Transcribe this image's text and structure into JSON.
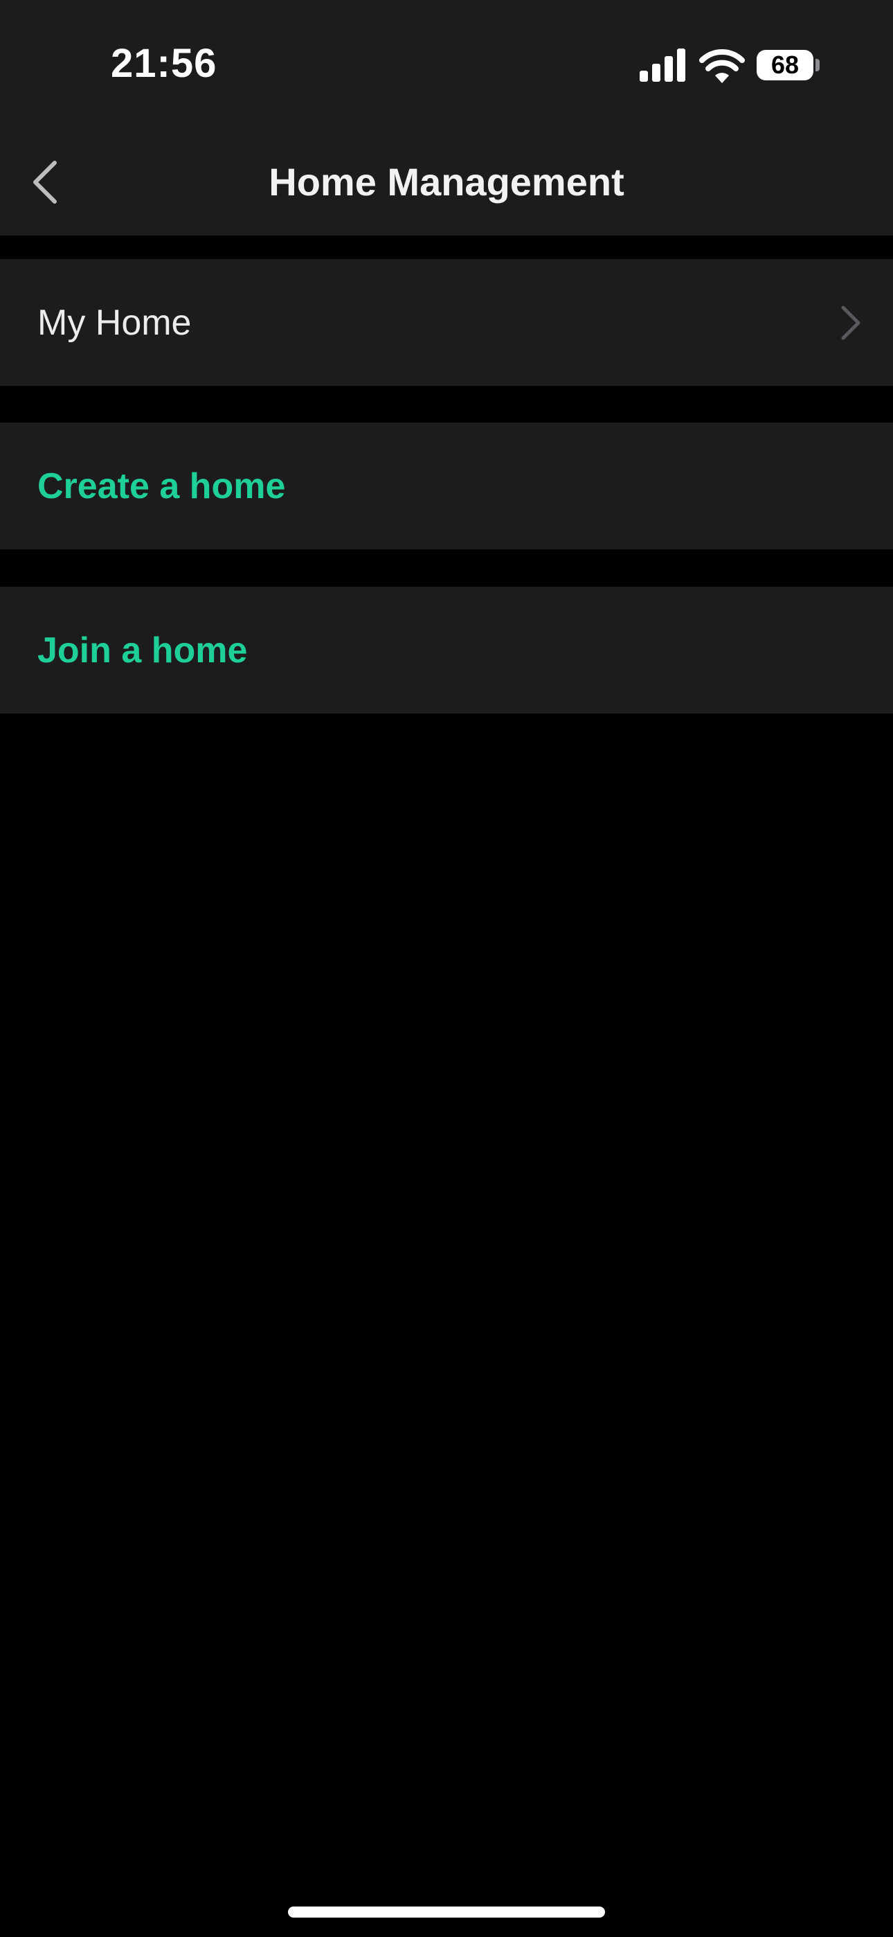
{
  "status_bar": {
    "time": "21:56",
    "battery_level": "68",
    "signal_icon": "cellular-signal-icon",
    "wifi_icon": "wifi-icon"
  },
  "nav": {
    "title": "Home Management",
    "back_icon": "chevron-left-icon"
  },
  "rows": {
    "my_home": {
      "label": "My Home",
      "icon": "chevron-right-icon"
    },
    "create": {
      "label": "Create a home"
    },
    "join": {
      "label": "Join a home"
    }
  },
  "colors": {
    "accent": "#1fcf98",
    "surface": "#1c1c1e",
    "background": "#000000"
  }
}
